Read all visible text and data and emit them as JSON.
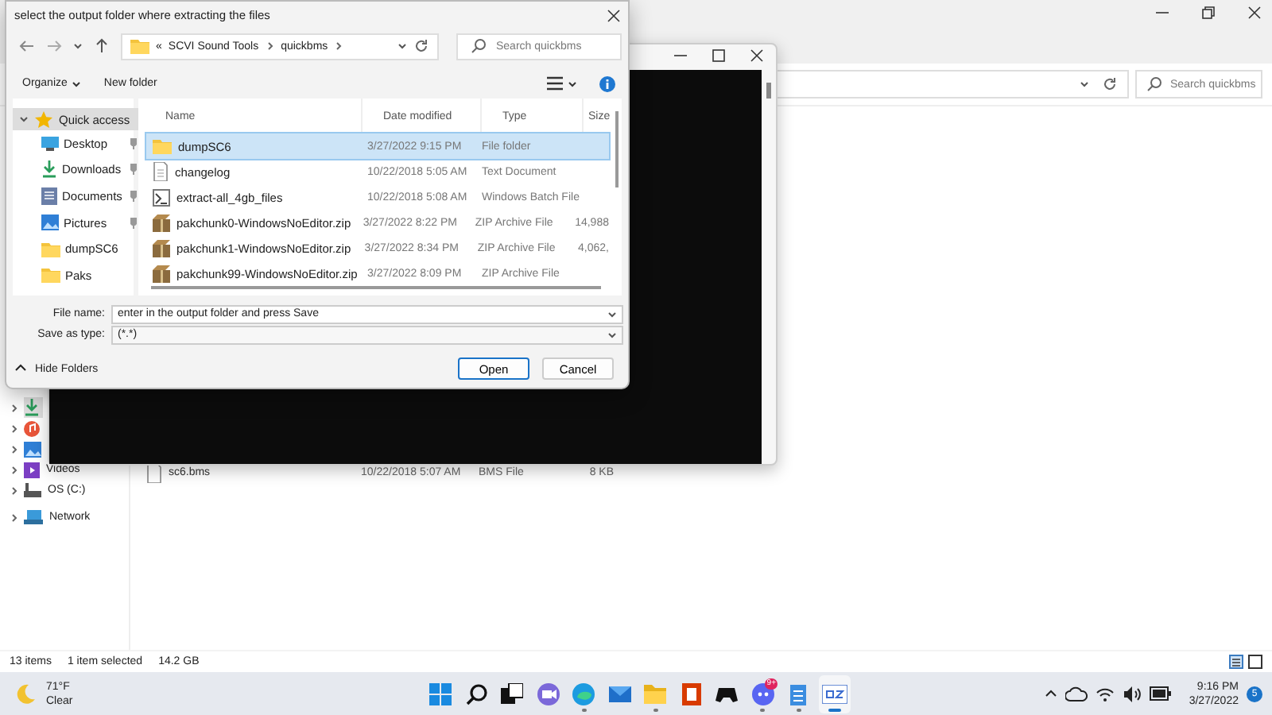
{
  "explorer": {
    "search": {
      "placeholder": "Search quickbms"
    },
    "nav_items": [
      {
        "kind": "download",
        "selected": true
      },
      {
        "kind": "music",
        "selected": false
      },
      {
        "kind": "pictures",
        "selected": false
      },
      {
        "label": "Videos",
        "kind": "videos",
        "selected": false
      },
      {
        "label": "OS (C:)",
        "kind": "drive",
        "selected": false
      },
      {
        "label": "Network",
        "kind": "network",
        "selected": false
      }
    ],
    "files": [
      {
        "name": "sc6.bms",
        "kind": "bms",
        "date": "10/22/2018 5:07 AM",
        "type": "BMS File",
        "size": "8 KB"
      }
    ],
    "status_bar": {
      "count": "13 items",
      "selection": "1 item selected",
      "selection_size": "14.2 GB"
    }
  },
  "dialog": {
    "title": "select the output folder where extracting the files",
    "breadcrumb": {
      "overflow": "«",
      "parts": [
        "SCVI Sound Tools",
        "quickbms"
      ]
    },
    "search": {
      "placeholder": "Search quickbms"
    },
    "toolbar": {
      "organize": "Organize",
      "new_folder": "New folder"
    },
    "quick_access": {
      "label": "Quick access",
      "expanded": true,
      "selected": true
    },
    "nav_items": [
      {
        "label": "Desktop",
        "kind": "desktop",
        "pinned": true,
        "selected": false
      },
      {
        "label": "Downloads",
        "kind": "download",
        "pinned": true,
        "selected": false
      },
      {
        "label": "Documents",
        "kind": "documents",
        "pinned": true,
        "selected": false
      },
      {
        "label": "Pictures",
        "kind": "pictures",
        "pinned": true,
        "selected": false
      },
      {
        "label": "dumpSC6",
        "kind": "folder",
        "pinned": false,
        "selected": false
      },
      {
        "label": "Paks",
        "kind": "folder",
        "pinned": false,
        "selected": false
      }
    ],
    "columns": [
      "Name",
      "Date modified",
      "Type",
      "Size"
    ],
    "files": [
      {
        "name": "dumpSC6",
        "kind": "folder",
        "date": "3/27/2022 9:15 PM",
        "type": "File folder",
        "selected": true
      },
      {
        "name": "changelog",
        "kind": "text",
        "date": "10/22/2018 5:05 AM",
        "type": "Text Document",
        "selected": false
      },
      {
        "name": "extract-all_4gb_files",
        "kind": "batch",
        "date": "10/22/2018 5:08 AM",
        "type": "Windows Batch File",
        "selected": false
      },
      {
        "name": "pakchunk0-WindowsNoEditor.zip",
        "kind": "zip",
        "date": "3/27/2022 8:22 PM",
        "type": "ZIP Archive File",
        "size": "14,988",
        "selected": false
      },
      {
        "name": "pakchunk1-WindowsNoEditor.zip",
        "kind": "zip",
        "date": "3/27/2022 8:34 PM",
        "type": "ZIP Archive File",
        "size": "4,062,",
        "selected": false
      },
      {
        "name": "pakchunk99-WindowsNoEditor.zip",
        "kind": "zip",
        "date": "3/27/2022 8:09 PM",
        "type": "ZIP Archive File",
        "selected": false
      }
    ],
    "file_name": {
      "label": "File name:",
      "value": "enter in the output folder and press Save"
    },
    "save_type": {
      "label": "Save as type:",
      "value": "(*.*)"
    },
    "hide_folders": "Hide Folders",
    "buttons": [
      {
        "label": "Open",
        "kind": "primary"
      },
      {
        "label": "Cancel",
        "kind": "secondary"
      }
    ]
  },
  "taskbar": {
    "weather": {
      "temperature": "71°F",
      "condition": "Clear"
    },
    "apps": [
      {
        "kind": "start",
        "running": false,
        "selected": false
      },
      {
        "kind": "search",
        "running": false,
        "selected": false
      },
      {
        "kind": "task_view",
        "running": false,
        "selected": false
      },
      {
        "kind": "meet",
        "running": false,
        "selected": false
      },
      {
        "kind": "browser",
        "running": true,
        "selected": false
      },
      {
        "kind": "mail",
        "running": false,
        "selected": false
      },
      {
        "kind": "files",
        "running": true,
        "selected": false
      },
      {
        "kind": "office",
        "running": false,
        "selected": false
      },
      {
        "kind": "games",
        "running": false,
        "selected": false
      },
      {
        "kind": "chat",
        "running": true,
        "selected": false,
        "badge": "9+"
      },
      {
        "kind": "notes",
        "running": true,
        "selected": false
      },
      {
        "kind": "tool",
        "running": true,
        "selected": true
      }
    ],
    "time": "9:16 PM",
    "date": "3/27/2022",
    "notifications": "5"
  }
}
